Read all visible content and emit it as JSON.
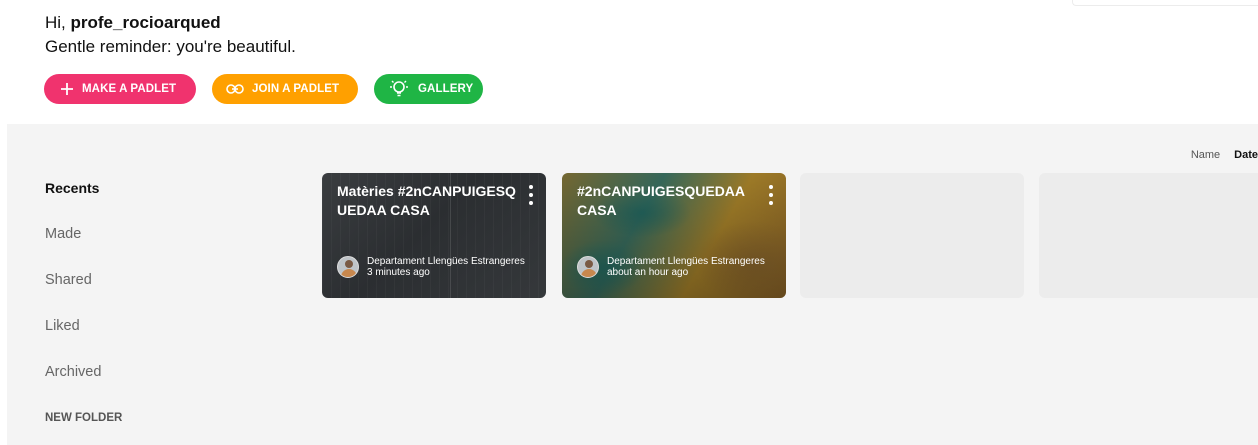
{
  "header": {
    "greeting_prefix": "Hi, ",
    "username": "profe_rocioarqued",
    "reminder": "Gentle reminder: you're beautiful."
  },
  "actions": [
    {
      "label": "MAKE A PADLET",
      "icon": "plus-icon",
      "color": "#f0336e"
    },
    {
      "label": "JOIN A PADLET",
      "icon": "link-icon",
      "color": "#ffa000"
    },
    {
      "label": "GALLERY",
      "icon": "lightbulb-icon",
      "color": "#1fb545"
    }
  ],
  "sort": {
    "options": [
      "Name",
      "Date"
    ],
    "active": "Date"
  },
  "sidebar": {
    "items": [
      {
        "label": "Recents",
        "active": true
      },
      {
        "label": "Made"
      },
      {
        "label": "Shared"
      },
      {
        "label": "Liked"
      },
      {
        "label": "Archived"
      }
    ],
    "new_folder": "NEW FOLDER"
  },
  "padlets": [
    {
      "title": "Matèries #2nCANPUIGESQUEDAA CASA",
      "owner": "Departament Llengües Estrangeres",
      "time": "3 minutes ago"
    },
    {
      "title": "#2nCANPUIGESQUEDAA CASA",
      "owner": "Departament Llengües Estrangeres",
      "time": "about an hour ago"
    }
  ]
}
